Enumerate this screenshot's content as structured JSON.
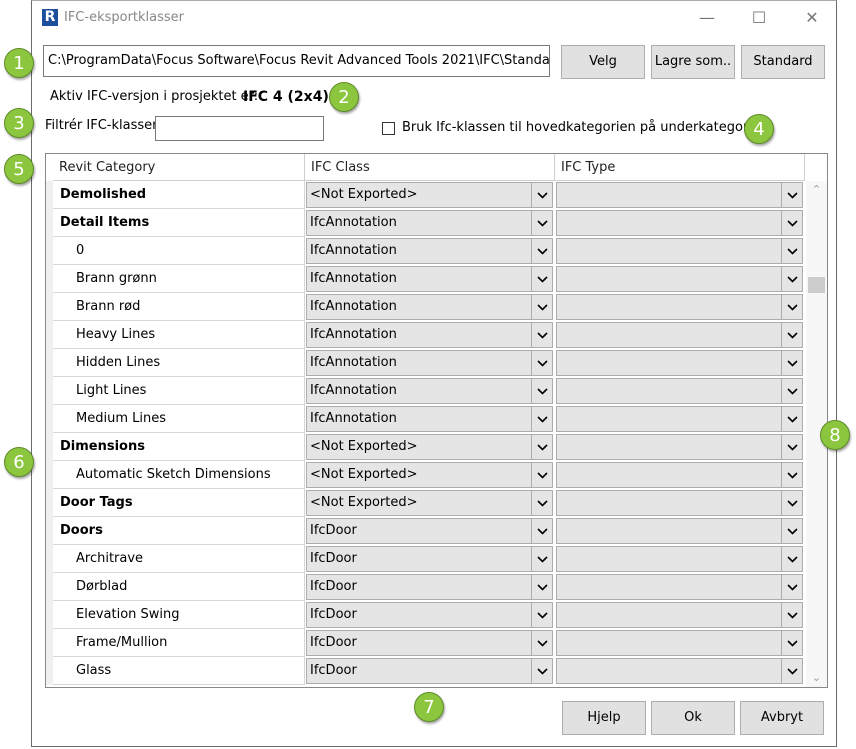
{
  "window": {
    "title": "IFC-eksportklasser",
    "app_icon_letter": "R"
  },
  "path_field": {
    "value": "C:\\ProgramData\\Focus Software\\Focus Revit Advanced Tools 2021\\IFC\\Standard RAT"
  },
  "buttons": {
    "select": "Velg",
    "save_as": "Lagre som..",
    "default": "Standard",
    "help": "Hjelp",
    "ok": "Ok",
    "cancel": "Avbryt"
  },
  "ifc_version": {
    "label": "Aktiv IFC-versjon i prosjektet er:",
    "value": "IFC 4 (2x4)"
  },
  "filter": {
    "label": "Filtrér IFC-klasser:",
    "value": ""
  },
  "checkbox": {
    "label": "Bruk Ifc-klassen til hovedkategorien på underkategorier.",
    "checked": false
  },
  "grid": {
    "columns": [
      "Revit Category",
      "IFC Class",
      "IFC Type"
    ],
    "rows": [
      {
        "category": "Demolished",
        "level": "parent",
        "ifc_class": "<Not Exported>",
        "ifc_type": ""
      },
      {
        "category": "Detail Items",
        "level": "parent",
        "ifc_class": "IfcAnnotation",
        "ifc_type": ""
      },
      {
        "category": "0",
        "level": "child",
        "ifc_class": "IfcAnnotation",
        "ifc_type": ""
      },
      {
        "category": "Brann grønn",
        "level": "child",
        "ifc_class": "IfcAnnotation",
        "ifc_type": ""
      },
      {
        "category": "Brann rød",
        "level": "child",
        "ifc_class": "IfcAnnotation",
        "ifc_type": ""
      },
      {
        "category": "Heavy Lines",
        "level": "child",
        "ifc_class": "IfcAnnotation",
        "ifc_type": ""
      },
      {
        "category": "Hidden Lines",
        "level": "child",
        "ifc_class": "IfcAnnotation",
        "ifc_type": ""
      },
      {
        "category": "Light Lines",
        "level": "child",
        "ifc_class": "IfcAnnotation",
        "ifc_type": ""
      },
      {
        "category": "Medium Lines",
        "level": "child",
        "ifc_class": "IfcAnnotation",
        "ifc_type": ""
      },
      {
        "category": "Dimensions",
        "level": "parent",
        "ifc_class": "<Not Exported>",
        "ifc_type": ""
      },
      {
        "category": "Automatic Sketch Dimensions",
        "level": "child",
        "ifc_class": "<Not Exported>",
        "ifc_type": ""
      },
      {
        "category": "Door Tags",
        "level": "parent",
        "ifc_class": "<Not Exported>",
        "ifc_type": ""
      },
      {
        "category": "Doors",
        "level": "parent",
        "ifc_class": "IfcDoor",
        "ifc_type": ""
      },
      {
        "category": "Architrave",
        "level": "child",
        "ifc_class": "IfcDoor",
        "ifc_type": ""
      },
      {
        "category": "Dørblad",
        "level": "child",
        "ifc_class": "IfcDoor",
        "ifc_type": ""
      },
      {
        "category": "Elevation Swing",
        "level": "child",
        "ifc_class": "IfcDoor",
        "ifc_type": ""
      },
      {
        "category": "Frame/Mullion",
        "level": "child",
        "ifc_class": "IfcDoor",
        "ifc_type": ""
      },
      {
        "category": "Glass",
        "level": "child",
        "ifc_class": "IfcDoor",
        "ifc_type": ""
      }
    ]
  },
  "callouts": [
    "1",
    "2",
    "3",
    "4",
    "5",
    "6",
    "7",
    "8"
  ],
  "colors": {
    "callout": "#8cc63e",
    "button_face": "#e1e1e1",
    "combo_face": "#e5e5e5"
  }
}
